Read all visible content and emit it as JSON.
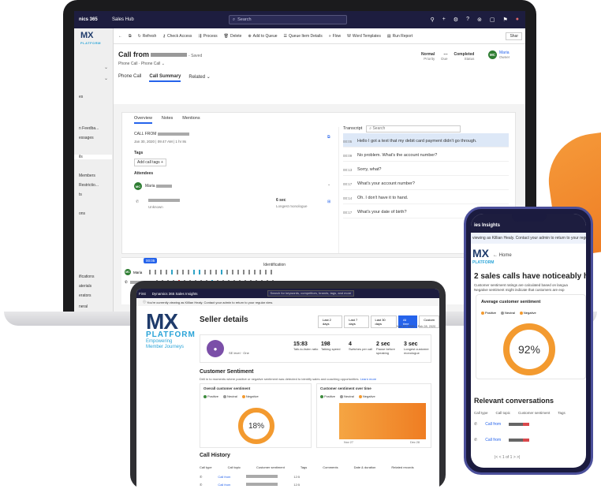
{
  "laptop": {
    "app_name": "nics 365",
    "hub": "Sales Hub",
    "search_placeholder": "Search",
    "nav_items": [
      "es",
      "n Feedba...",
      "essages",
      "ils",
      "Members",
      "Restrictio...",
      "ts",
      "ons",
      "ifications",
      "aterials",
      "erators",
      "neral"
    ],
    "commands": [
      "Refresh",
      "Check Access",
      "Process",
      "Delete",
      "Add to Queue",
      "Queue Item Details",
      "Flow",
      "Word Templates",
      "Run Report"
    ],
    "share": "Shar",
    "record_title": "Call from",
    "saved": "- Saved",
    "entity": "Phone Call",
    "form": "Phone Call",
    "tabs": [
      "Phone Call",
      "Call Summary",
      "Related"
    ],
    "priority_value": "Normal",
    "priority_label": "Priority",
    "due_value": "---",
    "due_label": "Due",
    "status_value": "Completed",
    "status_label": "Status",
    "owner_initials": "MC",
    "owner_name": "Maria",
    "owner_label": "Owner",
    "inner_tabs": [
      "Overview",
      "Notes",
      "Mentions"
    ],
    "call_from": "CALL FROM",
    "call_date": "Jan 30, 2020 | 09:47 AM | 1 hr 8s",
    "tags_label": "Tags",
    "add_tags": "Add call tags",
    "attendees_label": "Attendees",
    "attendee_initials": "MC",
    "attendee_name": "Maria",
    "unknown": "Unknown",
    "monologue_value": "6 sec",
    "monologue_label": "Longest monologue",
    "transcript_label": "Transcript",
    "transcript_search": "Search",
    "transcript": [
      {
        "time": "00:05",
        "text": "Hello I got a text that my debit card payment didn't go through."
      },
      {
        "time": "00:09",
        "text": "No problem. What's the account number?"
      },
      {
        "time": "00:13",
        "text": "Sorry, what?"
      },
      {
        "time": "00:17",
        "text": "What's your account number?"
      },
      {
        "time": "00:14",
        "text": "Oh. I don't have it to hand."
      },
      {
        "time": "00:17",
        "text": "What's your date of birth?"
      }
    ],
    "timeline_time": "00:05",
    "timeline_label": "Identification",
    "timeline_rows": [
      "Maria",
      ""
    ]
  },
  "tablet": {
    "brand": "First",
    "app": "Dynamics 365 Sales Insights",
    "search": "Search for keywords, competitors, brands, tags, and more",
    "banner": "You're currently viewing as Killian Healy. Contact your admin to return to your regular view.",
    "logo_mx": "MX",
    "logo_platform": "PLATFORM",
    "logo_tag_1": "Empowering",
    "logo_tag_2": "Member Journeys",
    "title": "Seller details",
    "filters": [
      "Last 2 days",
      "Last 7 days",
      "Last 30 days",
      "All time",
      "Custom"
    ],
    "range": "Nov 27, 2020 – Feb 28, 2020",
    "seller_role": "SE level",
    "seller_team": "One",
    "stats": [
      {
        "value": "15:83",
        "label": "Talk-to-listen ratio"
      },
      {
        "value": "198",
        "label": "Talking speed"
      },
      {
        "value": "4",
        "label": "Switches per call"
      },
      {
        "value": "2 sec",
        "label": "Pause before speaking"
      },
      {
        "value": "3 sec",
        "label": "Longest customer monologue"
      }
    ],
    "sentiment_title": "Customer Sentiment",
    "sentiment_sub": "Drill in to moments where positive or negative sentiment was detected to identify sales and coaching opportunities.",
    "learn_more": "Learn more",
    "overall_label": "Overall customer sentiment",
    "over_time_label": "Customer sentiment over time",
    "legend": [
      "Positive",
      "Neutral",
      "Negative"
    ],
    "overall_percent": "18%",
    "x_ticks": [
      "Nov 27",
      "Dec 28"
    ],
    "history_title": "Call History",
    "history_cols": [
      "Call type",
      "Call topic",
      "Customer sentiment",
      "Tags",
      "Comments",
      "Date & duration",
      "Related records"
    ],
    "history_rows": [
      {
        "topic": "Call from",
        "dur": "12:5"
      },
      {
        "topic": "Call from",
        "dur": "12:5"
      }
    ]
  },
  "phone": {
    "app": "ies Insights",
    "banner": "viewing as Killian Healy. Contact your admin to return to your regular view.",
    "home": "Home",
    "logo_mx": "MX",
    "logo_platform": "PLATFORM",
    "headline": "2 sales calls have noticeably high",
    "desc_1": "Customer sentiment ratings are calculated based on langua",
    "desc_2": "Negative sentiment might indicate that customers are exp",
    "card_title": "Average customer sentiment",
    "legend": [
      "Positive",
      "Neutral",
      "Negative"
    ],
    "percent": "92%",
    "relevant_title": "Relevant conversations",
    "cols": [
      "Call type",
      "Call topic",
      "Customer sentiment",
      "Tags"
    ],
    "rows": [
      "Call from",
      "Call from"
    ],
    "pager": "of 1"
  },
  "colors": {
    "accent": "#2563eb",
    "brand_navy": "#1d1d3f",
    "orange": "#f28a30",
    "ring_orange": "#f39a2f"
  }
}
